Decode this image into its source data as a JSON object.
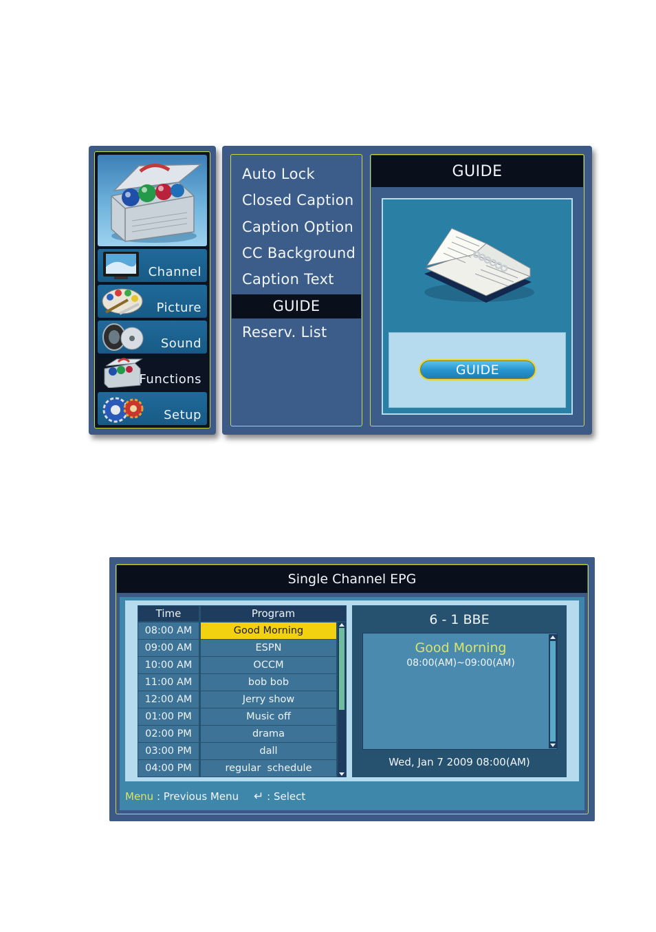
{
  "sidebar": {
    "categories": [
      {
        "label": "Channel",
        "selected": false
      },
      {
        "label": "Picture",
        "selected": false
      },
      {
        "label": "Sound",
        "selected": false
      },
      {
        "label": "Functions",
        "selected": true
      },
      {
        "label": "Setup",
        "selected": false
      }
    ]
  },
  "menu": {
    "items": [
      {
        "label": "Auto Lock"
      },
      {
        "label": "Closed Caption"
      },
      {
        "label": "Caption Option"
      },
      {
        "label": "CC Background"
      },
      {
        "label": "Caption Text"
      },
      {
        "label": "GUIDE"
      },
      {
        "label": "Reserv. List"
      }
    ],
    "selected": "GUIDE"
  },
  "preview": {
    "title": "GUIDE",
    "button_label": "GUIDE"
  },
  "epg": {
    "title": "Single Channel EPG",
    "columns": {
      "time": "Time",
      "program": "Program"
    },
    "rows": [
      {
        "time": "08:00 AM",
        "program": "Good Morning"
      },
      {
        "time": "09:00 AM",
        "program": "ESPN"
      },
      {
        "time": "10:00 AM",
        "program": "OCCM"
      },
      {
        "time": "11:00 AM",
        "program": "bob bob"
      },
      {
        "time": "12:00 AM",
        "program": "Jerry show"
      },
      {
        "time": "01:00 PM",
        "program": "Music off"
      },
      {
        "time": "02:00 PM",
        "program": "drama"
      },
      {
        "time": "03:00 PM",
        "program": "dall"
      },
      {
        "time": "04:00 PM",
        "program": "regular  schedule"
      }
    ],
    "selected_row": 0,
    "channel": "6 - 1 BBE",
    "detail": {
      "program": "Good Morning",
      "time_range": "08:00(AM)~09:00(AM)"
    },
    "datetime": "Wed, Jan 7 2009 08:00(AM)",
    "footer": {
      "menu_key": "Menu",
      "menu_action": " : Previous Menu",
      "enter_symbol": "↵",
      "enter_action": " : Select"
    }
  },
  "colors": {
    "panel": "#3d5a86",
    "dark_bar": "#0a0f1c",
    "accent_border": "#c8d84a",
    "selection_yellow": "#f2d210",
    "detail_title": "#d9e56a"
  }
}
